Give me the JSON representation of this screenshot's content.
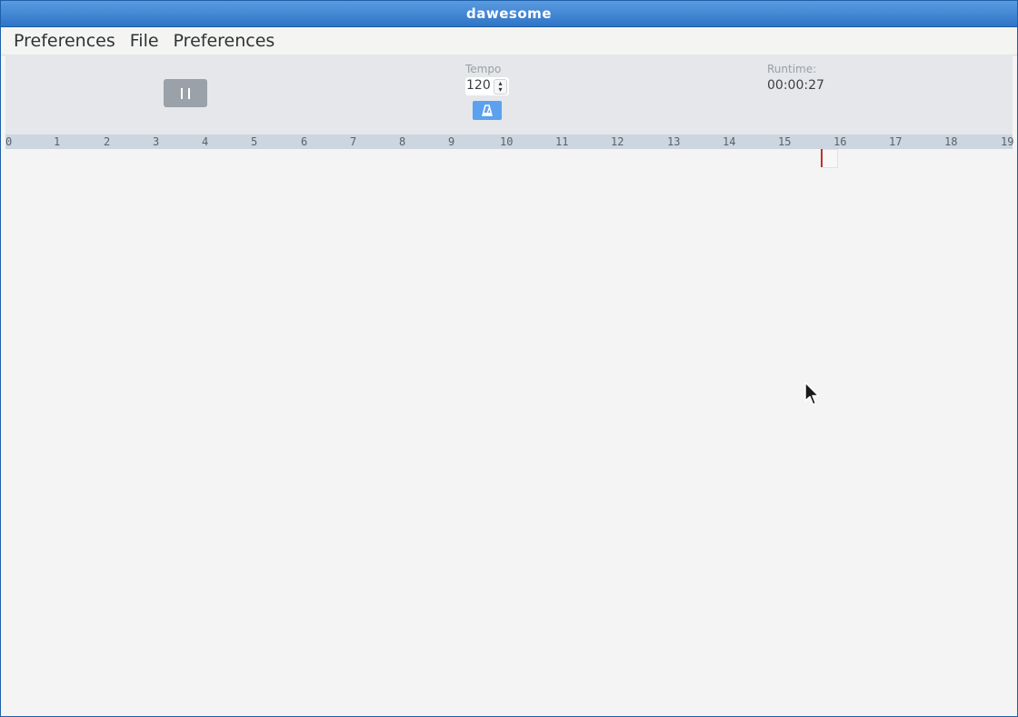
{
  "window": {
    "title": "dawesome"
  },
  "menubar": {
    "items": [
      "Preferences",
      "File",
      "Preferences"
    ]
  },
  "transport": {
    "tempo_label": "Tempo",
    "tempo_value": "120",
    "runtime_label": "Runtime:",
    "runtime_value": "00:00:27",
    "pause_icon": "pause-icon",
    "metronome_icon": "metronome-icon"
  },
  "ruler": {
    "ticks": [
      "0",
      "1",
      "2",
      "3",
      "4",
      "5",
      "6",
      "7",
      "8",
      "9",
      "10",
      "11",
      "12",
      "13",
      "14",
      "15",
      "16",
      "17",
      "18",
      "19"
    ]
  },
  "colors": {
    "titlebar": "#2f74c7",
    "accent": "#5ba1ef",
    "playhead": "#c0302d",
    "ruler": "#ccd6e0",
    "pause_button": "#9aa1a9"
  }
}
